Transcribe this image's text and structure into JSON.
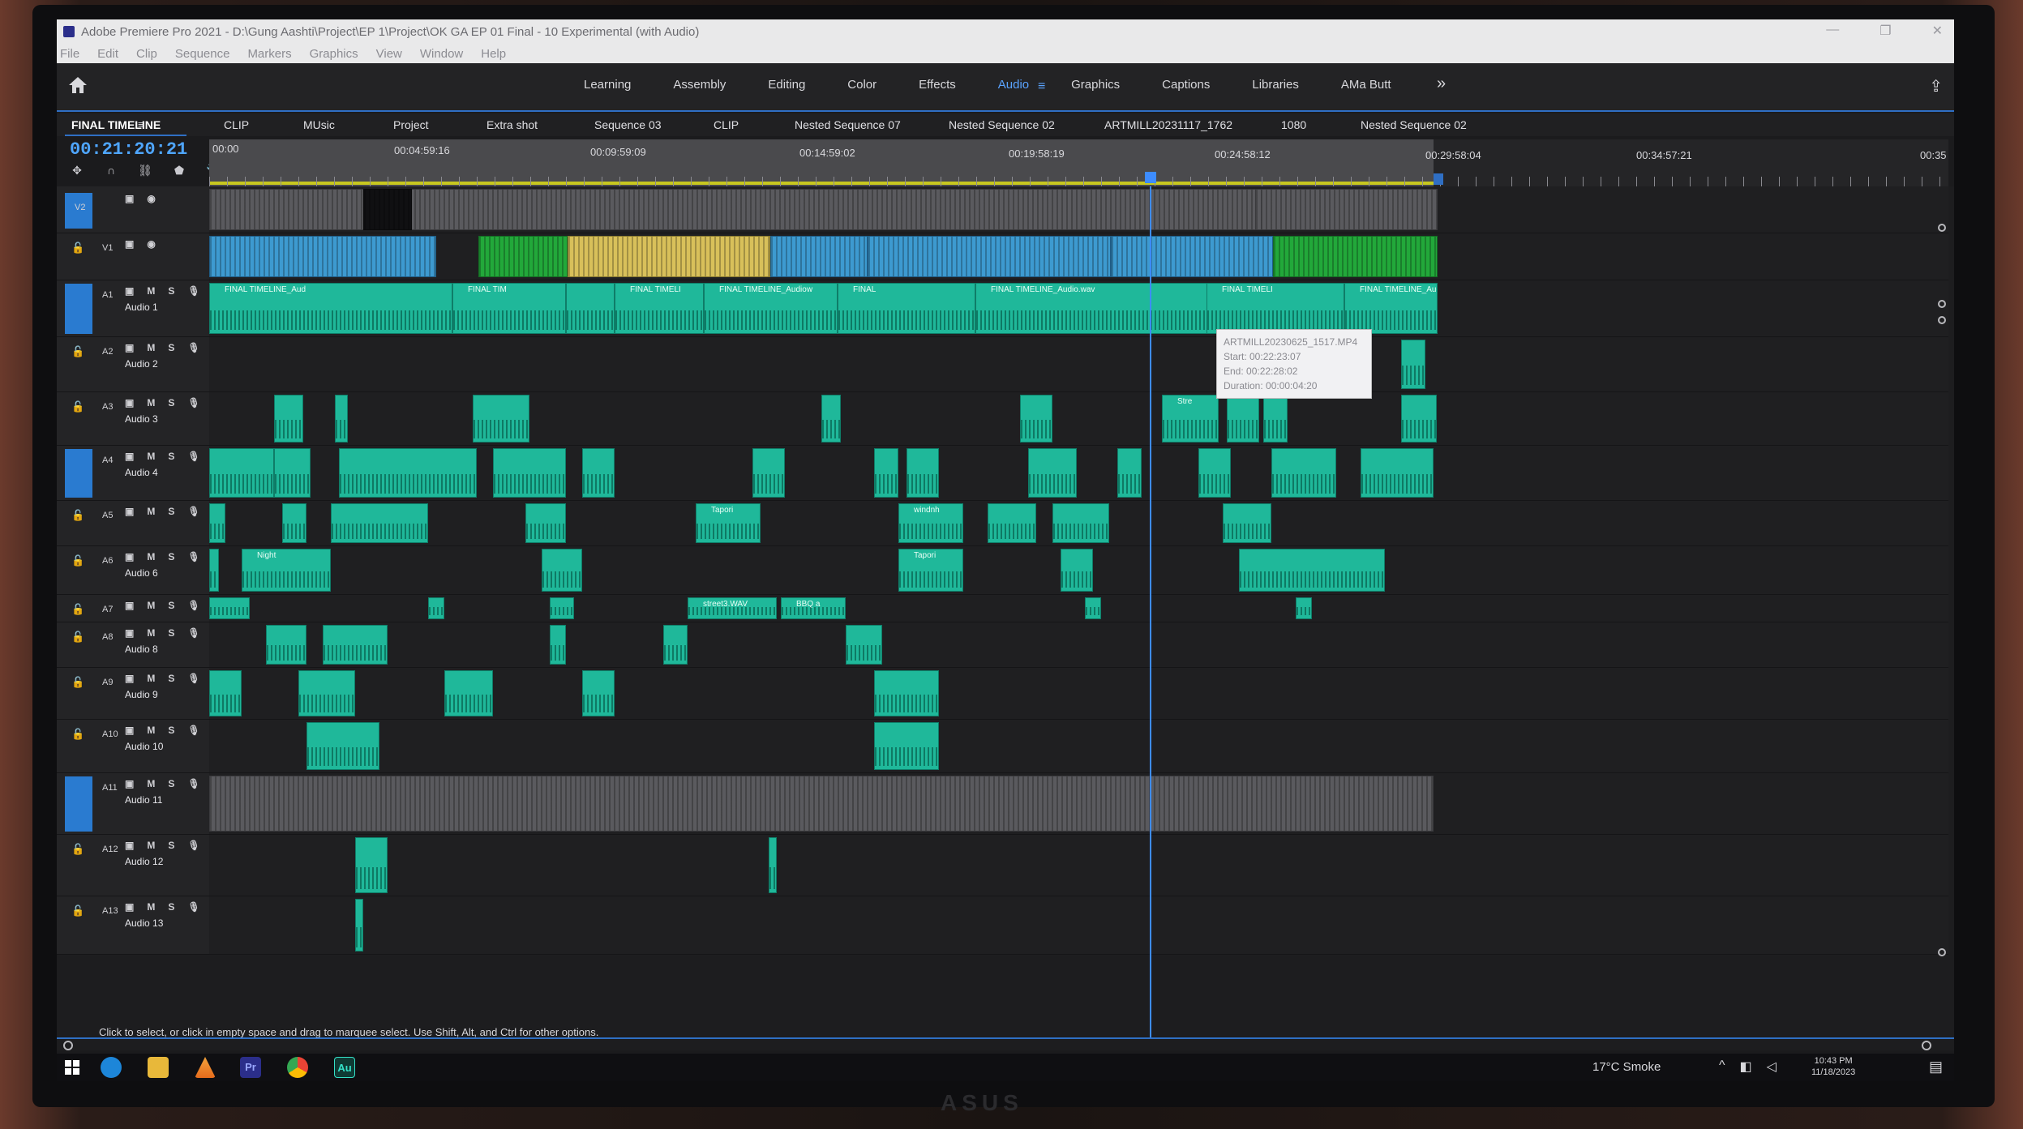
{
  "window": {
    "title": "Adobe Premiere Pro 2021 - D:\\Gung Aashti\\Project\\EP 1\\Project\\OK GA EP 01 Final - 10 Experimental (with Audio)"
  },
  "menu": [
    "File",
    "Edit",
    "Clip",
    "Sequence",
    "Markers",
    "Graphics",
    "View",
    "Window",
    "Help"
  ],
  "workspaces": {
    "tabs": [
      "Learning",
      "Assembly",
      "Editing",
      "Color",
      "Effects",
      "Audio",
      "Graphics",
      "Captions",
      "Libraries",
      "AMa Butt"
    ],
    "active": "Audio",
    "more": "»"
  },
  "sequence_tabs": [
    {
      "label": "FINAL TIMELINE",
      "active": true
    },
    {
      "label": "CLIP"
    },
    {
      "label": "MUsic"
    },
    {
      "label": "Project"
    },
    {
      "label": "Extra shot"
    },
    {
      "label": "Sequence 03"
    },
    {
      "label": "CLIP"
    },
    {
      "label": "Nested Sequence 07"
    },
    {
      "label": "Nested Sequence 02"
    },
    {
      "label": "ARTMILL20231117_1762"
    },
    {
      "label": "1080"
    },
    {
      "label": "Nested Sequence 02"
    }
  ],
  "timeline": {
    "timecode": "00:21:20:21",
    "ruler_labels": [
      "00:00",
      "00:04:59:16",
      "00:09:59:09",
      "00:14:59:02",
      "00:19:58:19",
      "00:24:58:12",
      "00:29:58:04",
      "00:34:57:21",
      "00:35"
    ],
    "playhead_fraction": 0.52
  },
  "tracks": {
    "video": [
      {
        "id": "V2",
        "targeted": true
      },
      {
        "id": "V1",
        "targeted": false
      }
    ],
    "audio": [
      {
        "id": "A1",
        "name": "Audio 1",
        "targeted": true
      },
      {
        "id": "A2",
        "name": "Audio 2"
      },
      {
        "id": "A3",
        "name": "Audio 3"
      },
      {
        "id": "A4",
        "name": "Audio 4",
        "targeted": true
      },
      {
        "id": "A5",
        "name": ""
      },
      {
        "id": "A6",
        "name": "Audio 6"
      },
      {
        "id": "A7",
        "name": ""
      },
      {
        "id": "A8",
        "name": "Audio 8"
      },
      {
        "id": "A9",
        "name": "Audio 9"
      },
      {
        "id": "A10",
        "name": "Audio 10"
      },
      {
        "id": "A11",
        "name": "Audio 11",
        "targeted": true
      },
      {
        "id": "A12",
        "name": "Audio 12"
      },
      {
        "id": "A13",
        "name": "Audio 13"
      }
    ],
    "button_labels": {
      "m": "M",
      "s": "S"
    }
  },
  "clip_labels": {
    "a1_1": "FINAL TIMELINE_Aud",
    "a1_2": "FINAL TIM",
    "a1_3": "FINAL TIMELI",
    "a1_4": "FINAL TIMELINE_Audiow",
    "a1_5": "FINAL",
    "a1_6": "FINAL TIMELINE_Audio.wav",
    "a1_7": "FINAL TIMELI",
    "a1_8": "FINAL TIMELINE_Audio.wav",
    "a5_1": "Tapori",
    "a5_2": "windnh",
    "a6_1": "Night",
    "a6_2": "Tapori",
    "a7_1": "street3.WAV",
    "a7_2": "BBQ a",
    "a3_1": "Stre"
  },
  "tooltip": {
    "name": "ARTMILL20230625_1517.MP4",
    "start": "Start: 00:22:23:07",
    "end": "End: 00:22:28:02",
    "duration": "Duration: 00:00:04:20"
  },
  "status_text": "Click to select, or click in empty space and drag to marquee select. Use Shift, Alt, and Ctrl for other options.",
  "taskbar": {
    "weather": "17°C Smoke",
    "time": "10:43 PM",
    "date": "11/18/2023",
    "pr_label": "Pr",
    "au_label": "Au"
  },
  "colors": {
    "accent": "#2f6fc4",
    "timecode": "#4fa6ff",
    "audio_clip": "#1fb89a",
    "playhead": "#3d8cff"
  },
  "brand": "ASUS"
}
